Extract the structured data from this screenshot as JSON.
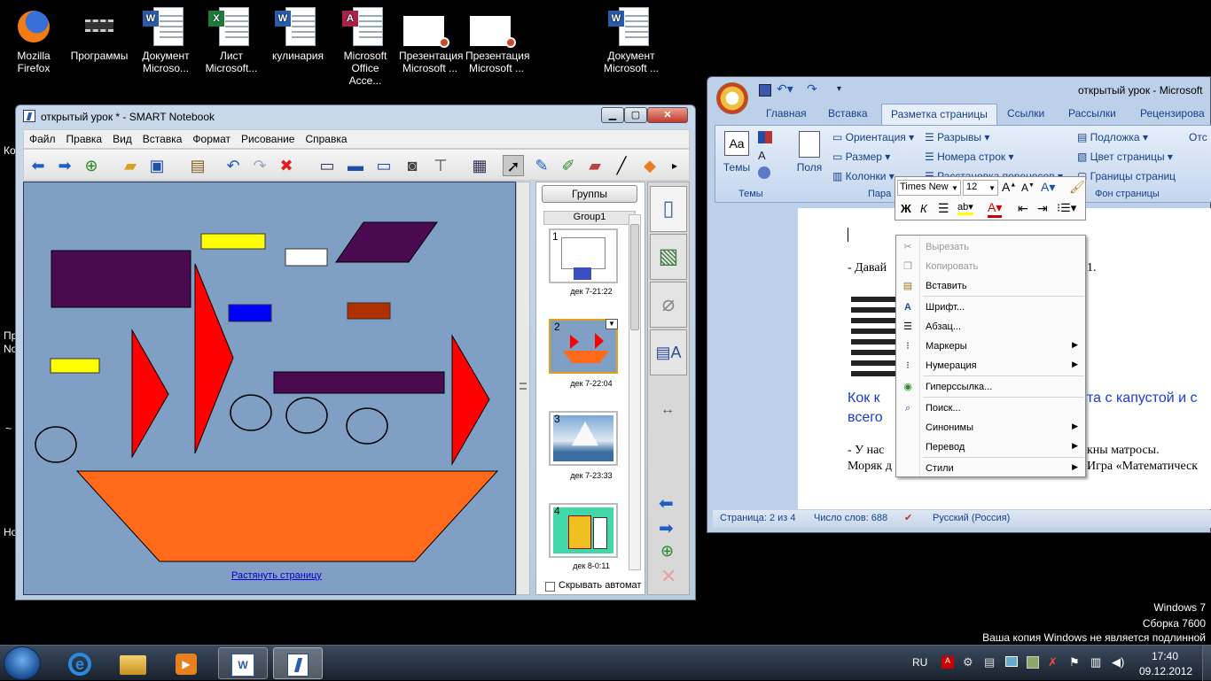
{
  "desktop": {
    "icons": [
      {
        "label": "Mozilla Firefox"
      },
      {
        "label": "Программы"
      },
      {
        "label": "Документ Microso..."
      },
      {
        "label": "Лист Microsoft..."
      },
      {
        "label": "кулинария"
      },
      {
        "label": "Microsoft Office Acce..."
      },
      {
        "label": "Презентация Microsoft ..."
      },
      {
        "label": "Презентация Microsoft ..."
      },
      {
        "label": "Документ Microsoft ..."
      }
    ],
    "left_fragments": [
      "Ко",
      "Пр",
      "Nо",
      "~",
      "Но"
    ]
  },
  "notebook": {
    "title": "открытый урок * - SMART Notebook",
    "menu": [
      "Файл",
      "Правка",
      "Вид",
      "Вставка",
      "Формат",
      "Рисование",
      "Справка"
    ],
    "groups_button": "Группы",
    "group_name": "Group1",
    "thumbs": [
      {
        "num": "1",
        "caption": "дек 7-21:22"
      },
      {
        "num": "2",
        "caption": "дек 7-22:04"
      },
      {
        "num": "3",
        "caption": "дек 7-23:33"
      },
      {
        "num": "4",
        "caption": "дек 8-0:11"
      }
    ],
    "autohide_label": "Скрывать автомат",
    "stretch_link": "Растянуть страницу"
  },
  "word": {
    "title": "открытый урок - Microsoft",
    "tabs": [
      "Главная",
      "Вставка",
      "Разметка страницы",
      "Ссылки",
      "Рассылки",
      "Рецензирова"
    ],
    "ribbon": {
      "themes": "Темы",
      "themes_group": "Темы",
      "fields": "Поля",
      "orientation": "Ориентация",
      "size": "Размер",
      "columns": "Колонки",
      "breaks": "Разрывы",
      "line_numbers": "Номера строк",
      "hyphenation": "Расстановка переносов",
      "page_group": "Пара",
      "watermark": "Подложка",
      "page_color": "Цвет страницы",
      "page_borders": "Границы страниц",
      "page_bg_group": "Фон страницы",
      "cut_right": "Отс"
    },
    "doc": {
      "line1": "- Давай",
      "line1b": "1.",
      "heading1": "Кок к",
      "heading1b": "та с капустой и с",
      "heading2": "всего",
      "line2": "- У нас",
      "line2b": "кны матросы.",
      "line3": "Моряк д",
      "line3b": "Игра «Математическ"
    },
    "status": {
      "page": "Страница: 2 из 4",
      "words": "Число слов: 688",
      "lang": "Русский (Россия)"
    }
  },
  "mini_toolbar": {
    "font": "Times New",
    "size": "12"
  },
  "context_menu": {
    "items": [
      {
        "label": "Вырезать",
        "icon": "cut-icon"
      },
      {
        "label": "Копировать",
        "icon": "copy-icon"
      },
      {
        "label": "Вставить",
        "icon": "paste-icon"
      },
      {
        "label": "Шрифт...",
        "icon": "font-icon"
      },
      {
        "label": "Абзац...",
        "icon": "paragraph-icon"
      },
      {
        "label": "Маркеры",
        "icon": "bullets-icon"
      },
      {
        "label": "Нумерация",
        "icon": "numbering-icon"
      },
      {
        "label": "Гиперссылка...",
        "icon": "hyperlink-icon"
      },
      {
        "label": "Поиск...",
        "icon": "search-icon"
      },
      {
        "label": "Синонимы",
        "icon": ""
      },
      {
        "label": "Перевод",
        "icon": ""
      },
      {
        "label": "Стили",
        "icon": ""
      }
    ]
  },
  "watermark": {
    "line1": "Windows 7",
    "line2": "Сборка 7600",
    "line3": "Ваша копия Windows не является подлинной"
  },
  "taskbar": {
    "lang": "RU",
    "time": "17:40",
    "date": "09.12.2012"
  },
  "colors": {
    "canvas_bg": "#809fc4",
    "purple": "#4a0a52",
    "red": "#ff0000",
    "orange": "#ff6a1a",
    "yellow": "#ffff00",
    "blue": "#0000ff",
    "brown": "#b03000"
  }
}
